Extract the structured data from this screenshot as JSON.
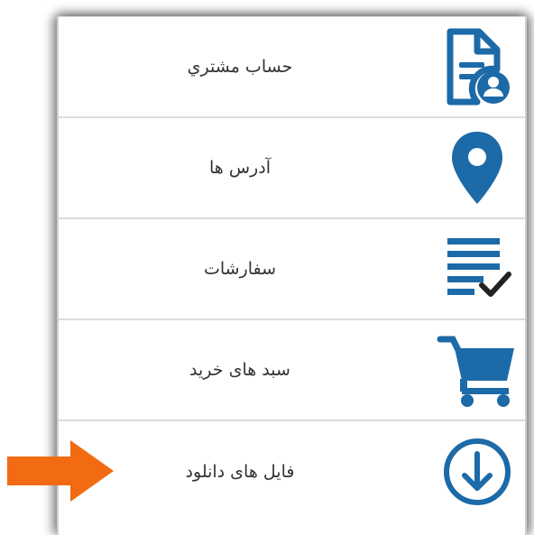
{
  "menu": {
    "items": [
      {
        "label": "حساب مشتري",
        "icon": "account-document-icon"
      },
      {
        "label": "آدرس ها",
        "icon": "location-pin-icon"
      },
      {
        "label": "سفارشات",
        "icon": "orders-list-check-icon"
      },
      {
        "label": "سبد های خرید",
        "icon": "shopping-cart-icon"
      },
      {
        "label": "فایل های دانلود",
        "icon": "download-circle-icon"
      }
    ]
  },
  "colors": {
    "icon_blue": "#1c6aa8",
    "arrow_orange": "#f26a12",
    "divider": "#dcdcdc"
  }
}
